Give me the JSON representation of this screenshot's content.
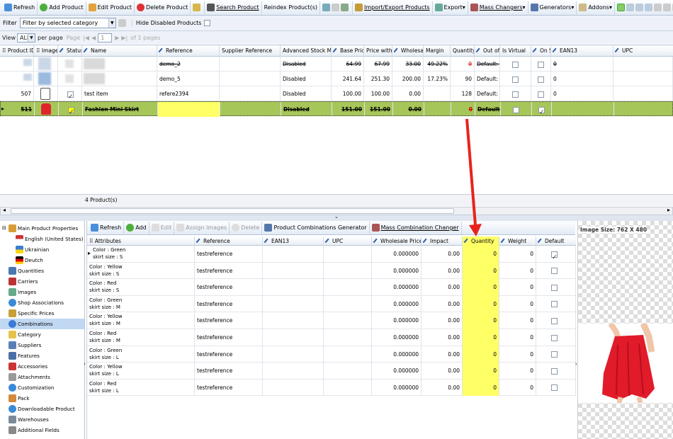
{
  "toolbar": {
    "refresh": "Refresh",
    "add": "Add Product",
    "edit": "Edit Product",
    "delete": "Delete Product",
    "search": "Search Product",
    "reindex": "Reindex Product(s)",
    "import_export": "Import/Export Products",
    "export": "Export",
    "mass": "Mass Changers",
    "generators": "Generators",
    "addons": "Addons"
  },
  "filter": {
    "label": "Filter",
    "value": "Filter by selected category",
    "hide_disabled": "Hide Disabled Products"
  },
  "pager": {
    "view": "View",
    "per_page_value": "ALL",
    "per_page": "per page",
    "page": "Page",
    "page_num": "1",
    "of_pages": "of 1 pages"
  },
  "products": {
    "columns": [
      "Product ID",
      "Image",
      "Status",
      "Name",
      "Reference",
      "Supplier Reference",
      "Advanced Stock Manage",
      "Base Price",
      "Price with Ta",
      "Wholesale F",
      "Margin",
      "Quantity",
      "Out of S",
      "Is Virtual",
      "On Sale",
      "EAN13",
      "UPC"
    ],
    "rows": [
      {
        "id": "",
        "name": "",
        "reference": "demo_2",
        "asm": "Disabled",
        "base": "64.99",
        "tax": "67.99",
        "wholesale": "33.00",
        "margin": "49.22%",
        "qty": "0",
        "out": "Default: De",
        "ean": "0",
        "status": false,
        "onsale": false
      },
      {
        "id": "",
        "name": "",
        "reference": "demo_5",
        "asm": "Disabled",
        "base": "241.64",
        "tax": "251.30",
        "wholesale": "200.00",
        "margin": "17.23%",
        "qty": "90",
        "out": "Default: De",
        "ean": "0",
        "status": false,
        "onsale": false
      },
      {
        "id": "507",
        "name": "test item",
        "reference": "refere2394",
        "asm": "Disabled",
        "base": "100.00",
        "tax": "100.00",
        "wholesale": "0.00",
        "margin": "",
        "qty": "128",
        "out": "Default: De",
        "ean": "0",
        "status": true,
        "onsale": false
      },
      {
        "id": "511",
        "name": "Fashion Mini Skirt",
        "reference": "",
        "asm": "Disabled",
        "base": "151.00",
        "tax": "151.00",
        "wholesale": "0.00",
        "margin": "",
        "qty": "0",
        "out": "Default: D",
        "ean": "",
        "status": true,
        "onsale": true
      }
    ],
    "count": "4 Product(s)"
  },
  "left_panel": {
    "items": [
      "Main Product Properties",
      "English (United States)",
      "Ukrainian",
      "Deutch",
      "Quantities",
      "Carriers",
      "Images",
      "Shop Associations",
      "Specific Prices",
      "Combinations",
      "Category",
      "Suppliers",
      "Features",
      "Accessories",
      "Attachments",
      "Customization",
      "Pack",
      "Downloadable Product",
      "Warehouses",
      "Additional Fields"
    ]
  },
  "combos_toolbar": {
    "refresh": "Refresh",
    "add": "Add",
    "edit": "Edit",
    "assign": "Assign Images",
    "delete": "Delete",
    "generator": "Product Combinations Generator",
    "mass": "Mass Combination Changer"
  },
  "combinations": {
    "columns": [
      "Attributes",
      "Reference",
      "EAN13",
      "UPC",
      "Wholesale Price",
      "Impact",
      "Quantity",
      "Weight",
      "Default"
    ],
    "rows": [
      {
        "color": "Color : Green",
        "size": "skirt size : S",
        "ref": "testreference",
        "wholesale": "0.000000",
        "impact": "0.00",
        "qty": "0",
        "weight": "0",
        "default": true
      },
      {
        "color": "Color : Yellow",
        "size": "skirt size : S",
        "ref": "testreference",
        "wholesale": "0.000000",
        "impact": "0.00",
        "qty": "0",
        "weight": "0",
        "default": false
      },
      {
        "color": "Color : Red",
        "size": "skirt size : S",
        "ref": "testreference",
        "wholesale": "0.000000",
        "impact": "0.00",
        "qty": "0",
        "weight": "0",
        "default": false
      },
      {
        "color": "Color : Green",
        "size": "skirt size : M",
        "ref": "testreference",
        "wholesale": "0.000000",
        "impact": "0.00",
        "qty": "0",
        "weight": "0",
        "default": false
      },
      {
        "color": "Color : Yellow",
        "size": "skirt size : M",
        "ref": "testreference",
        "wholesale": "0.000000",
        "impact": "0.00",
        "qty": "0",
        "weight": "0",
        "default": false
      },
      {
        "color": "Color : Red",
        "size": "skirt size : M",
        "ref": "testreference",
        "wholesale": "0.000000",
        "impact": "0.00",
        "qty": "0",
        "weight": "0",
        "default": false
      },
      {
        "color": "Color : Green",
        "size": "skirt size : L",
        "ref": "testreference",
        "wholesale": "0.000000",
        "impact": "0.00",
        "qty": "0",
        "weight": "0",
        "default": false
      },
      {
        "color": "Color : Yellow",
        "size": "skirt size : L",
        "ref": "testreference",
        "wholesale": "0.000000",
        "impact": "0.00",
        "qty": "0",
        "weight": "0",
        "default": false
      },
      {
        "color": "Color : Red",
        "size": "skirt size : L",
        "ref": "testreference",
        "wholesale": "0.000000",
        "impact": "0.00",
        "qty": "0",
        "weight": "0",
        "default": false
      }
    ]
  },
  "image_panel": {
    "size_label": "Image Size: 762 X 480"
  },
  "colors": {
    "selected_row": "#a7c65a",
    "highlight": "#ffff66",
    "arrow": "#e8231d"
  }
}
